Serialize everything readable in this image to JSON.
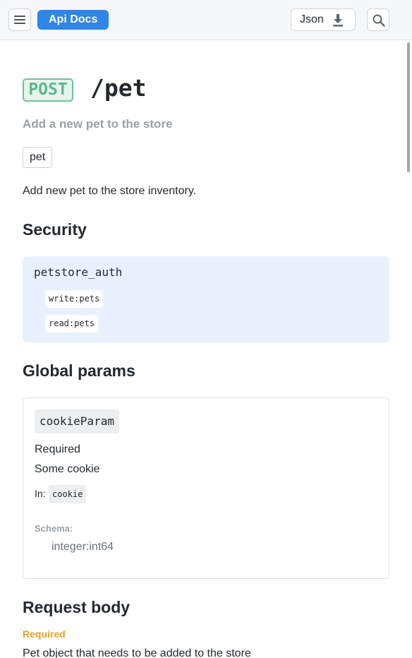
{
  "topbar": {
    "app_badge": "Api Docs",
    "json_button_label": "Json"
  },
  "operation": {
    "method": "POST",
    "path": "/pet",
    "summary": "Add a new pet to the store",
    "tag": "pet",
    "description": "Add new pet to the store inventory."
  },
  "security": {
    "heading": "Security",
    "scheme_name": "petstore_auth",
    "scopes": [
      "write:pets",
      "read:pets"
    ]
  },
  "global_params": {
    "heading": "Global params",
    "param": {
      "name": "cookieParam",
      "required_label": "Required",
      "description": "Some cookie",
      "in_label": "In:",
      "in_value": "cookie",
      "schema_label": "Schema:",
      "schema_value": "integer:int64"
    }
  },
  "request_body": {
    "heading": "Request body",
    "required_label": "Required",
    "description": "Pet object that needs to be added to the store"
  },
  "colors": {
    "accent": "#2f86e8",
    "post_method": "#5bb88d",
    "required": "#e3a324",
    "security_bg": "#e8f1fd"
  },
  "icons": [
    "menu-icon",
    "download-icon",
    "search-icon"
  ]
}
